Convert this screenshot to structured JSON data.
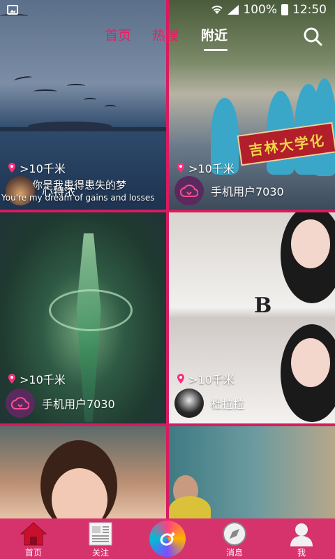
{
  "status_bar": {
    "battery_percent": "100%",
    "time": "12:50"
  },
  "top_nav": {
    "tabs": [
      {
        "label": "首页",
        "active": false
      },
      {
        "label": "热搜",
        "active": false
      },
      {
        "label": "附近",
        "active": true
      }
    ],
    "search_icon": "search-icon"
  },
  "feed": {
    "cards": [
      {
        "distance": ">10千米",
        "username": "心特浓",
        "subtitle_zh": "你是我患得患失的梦",
        "subtitle_en": "You're my dream of gains and losses",
        "avatar": "photo"
      },
      {
        "distance": ">10千米",
        "username": "手机用户7030",
        "banner_text": "吉林大学化",
        "avatar": "cloud-icon"
      },
      {
        "distance": ">10千米",
        "username": "手机用户7030",
        "avatar": "cloud-icon"
      },
      {
        "distance": ">10千米",
        "username": "杜拉拉",
        "shirt_logo": "B",
        "avatar": "photo"
      },
      {},
      {}
    ]
  },
  "bottom_nav": {
    "items": [
      {
        "label": "首页",
        "icon": "home-icon",
        "active": true
      },
      {
        "label": "关注",
        "icon": "newspaper-icon",
        "active": false
      },
      {
        "label": "",
        "icon": "camera-record-icon",
        "active": false
      },
      {
        "label": "消息",
        "icon": "compass-icon",
        "active": false
      },
      {
        "label": "我",
        "icon": "user-icon",
        "active": false
      }
    ]
  },
  "colors": {
    "accent": "#e91e63",
    "bottom_bar": "#d6336c",
    "grid_border": "#d81b60"
  }
}
